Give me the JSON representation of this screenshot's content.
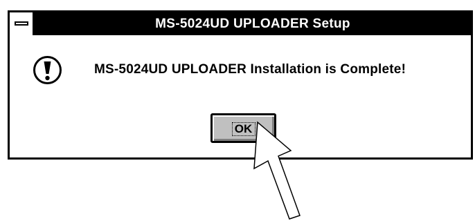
{
  "dialog": {
    "title": "MS-5024UD UPLOADER Setup",
    "message": "MS-5024UD UPLOADER Installation is Complete!",
    "icon": "exclamation-icon",
    "ok_label": "OK"
  },
  "window_controls": {
    "system_menu_icon": "system-menu-icon"
  },
  "annotation": {
    "icon": "arrow-pointer-icon"
  },
  "colors": {
    "titlebar": "#000000",
    "title_text": "#ffffff",
    "button_face": "#c0c0c0"
  }
}
